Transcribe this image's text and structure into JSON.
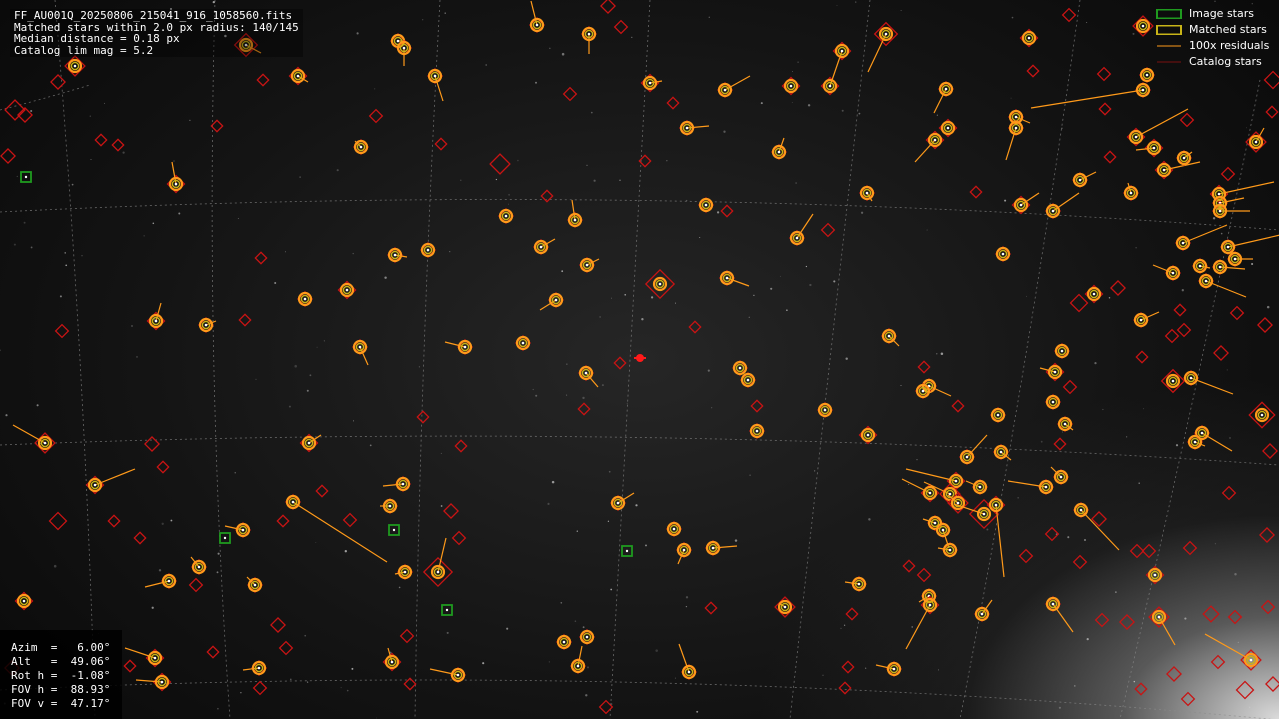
{
  "header": {
    "filename": "FF_AU001Q_20250806_215041_916_1058560.fits",
    "match_line": "Matched stars within 2.0 px radius: 140/145",
    "median_line": "Median distance = 0.18 px",
    "limmag_line": "Catalog lim mag = 5.2"
  },
  "pointing": {
    "azim": "Azim  =   6.00°",
    "alt": "Alt   =  49.06°",
    "roth": "Rot h =  -1.08°",
    "fovh": "FOV h =  88.93°",
    "fovv": "FOV v =  47.17°"
  },
  "legend": {
    "image_stars": "Image stars",
    "matched_stars": "Matched stars",
    "residuals": "100x residuals",
    "catalog_stars": "Catalog stars"
  },
  "colors": {
    "image_star": "#1f9a1f",
    "matched_star": "#c8b418",
    "residual": "#ff9a1a",
    "catalog_star": "#c81414",
    "grid": "#8c8c8c",
    "center_marker": "#ff1a1a"
  }
}
